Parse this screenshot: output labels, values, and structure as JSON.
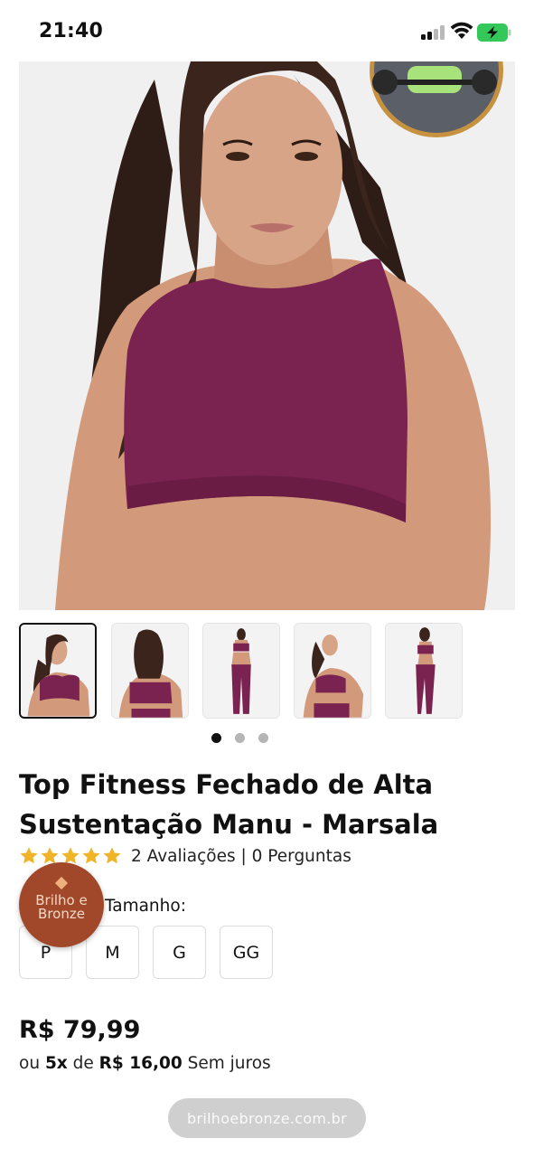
{
  "status_bar": {
    "time": "21:40",
    "signal_icon": "cellular-signal-icon",
    "wifi_icon": "wifi-icon",
    "battery_icon": "battery-charging-icon",
    "battery_color": "#34c759"
  },
  "product": {
    "title": "Top Fitness Fechado de Alta Sustentação Manu - Marsala",
    "rating": {
      "stars": 5,
      "reviews_text": "2 Avaliações | 0 Perguntas"
    },
    "images": {
      "hero_alt": "Top Fitness Marsala",
      "thumbnails": [
        "front",
        "back",
        "full-back",
        "front-pose",
        "side"
      ],
      "active_thumbnail": 0,
      "carousel_pages": 3,
      "active_page": 0
    },
    "size_label": "Tamanho:",
    "sizes": [
      "P",
      "M",
      "G",
      "GG"
    ],
    "price": "R$ 79,99",
    "installments": {
      "prefix": "ou",
      "count": "5x",
      "middle": "de",
      "value": "R$ 16,00",
      "suffix": "Sem juros"
    }
  },
  "brand": {
    "line1": "Brilho e",
    "line2": "Bronze",
    "color": "#a2482a"
  },
  "browser": {
    "url": "brilhoebronze.com.br"
  },
  "colors": {
    "star": "#f0b429",
    "product_color": "#7a2350"
  }
}
